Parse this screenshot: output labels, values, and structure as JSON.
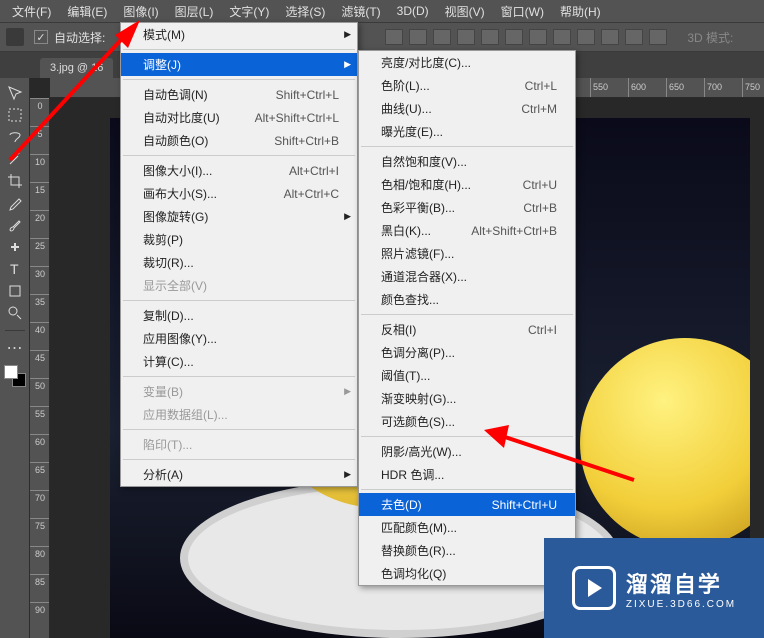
{
  "menubar": [
    "文件(F)",
    "编辑(E)",
    "图像(I)",
    "图层(L)",
    "文字(Y)",
    "选择(S)",
    "滤镜(T)",
    "3D(D)",
    "视图(V)",
    "窗口(W)",
    "帮助(H)"
  ],
  "options": {
    "auto_select": "自动选择:",
    "mode_3d": "3D 模式:"
  },
  "doc_tab": "3.jpg @ 16",
  "ruler_h": [
    "550",
    "600",
    "650",
    "700",
    "750"
  ],
  "ruler_v": [
    "0",
    "5",
    "10",
    "15",
    "20",
    "25",
    "30",
    "35",
    "40",
    "45",
    "50",
    "55",
    "60",
    "65",
    "70",
    "75",
    "80",
    "85",
    "90"
  ],
  "menu1": {
    "groups": [
      [
        {
          "label": "模式(M)",
          "arrow": true
        }
      ],
      [
        {
          "label": "调整(J)",
          "arrow": true,
          "hl": true
        }
      ],
      [
        {
          "label": "自动色调(N)",
          "shortcut": "Shift+Ctrl+L"
        },
        {
          "label": "自动对比度(U)",
          "shortcut": "Alt+Shift+Ctrl+L"
        },
        {
          "label": "自动颜色(O)",
          "shortcut": "Shift+Ctrl+B"
        }
      ],
      [
        {
          "label": "图像大小(I)...",
          "shortcut": "Alt+Ctrl+I"
        },
        {
          "label": "画布大小(S)...",
          "shortcut": "Alt+Ctrl+C"
        },
        {
          "label": "图像旋转(G)",
          "arrow": true
        },
        {
          "label": "裁剪(P)"
        },
        {
          "label": "裁切(R)..."
        },
        {
          "label": "显示全部(V)",
          "disabled": true
        }
      ],
      [
        {
          "label": "复制(D)..."
        },
        {
          "label": "应用图像(Y)..."
        },
        {
          "label": "计算(C)..."
        }
      ],
      [
        {
          "label": "变量(B)",
          "arrow": true,
          "disabled": true
        },
        {
          "label": "应用数据组(L)...",
          "disabled": true
        }
      ],
      [
        {
          "label": "陷印(T)...",
          "disabled": true
        }
      ],
      [
        {
          "label": "分析(A)",
          "arrow": true
        }
      ]
    ]
  },
  "menu2": {
    "groups": [
      [
        {
          "label": "亮度/对比度(C)..."
        },
        {
          "label": "色阶(L)...",
          "shortcut": "Ctrl+L"
        },
        {
          "label": "曲线(U)...",
          "shortcut": "Ctrl+M"
        },
        {
          "label": "曝光度(E)..."
        }
      ],
      [
        {
          "label": "自然饱和度(V)..."
        },
        {
          "label": "色相/饱和度(H)...",
          "shortcut": "Ctrl+U"
        },
        {
          "label": "色彩平衡(B)...",
          "shortcut": "Ctrl+B"
        },
        {
          "label": "黑白(K)...",
          "shortcut": "Alt+Shift+Ctrl+B"
        },
        {
          "label": "照片滤镜(F)..."
        },
        {
          "label": "通道混合器(X)..."
        },
        {
          "label": "颜色查找..."
        }
      ],
      [
        {
          "label": "反相(I)",
          "shortcut": "Ctrl+I"
        },
        {
          "label": "色调分离(P)..."
        },
        {
          "label": "阈值(T)..."
        },
        {
          "label": "渐变映射(G)..."
        },
        {
          "label": "可选颜色(S)..."
        }
      ],
      [
        {
          "label": "阴影/高光(W)..."
        },
        {
          "label": "HDR 色调..."
        }
      ],
      [
        {
          "label": "去色(D)",
          "shortcut": "Shift+Ctrl+U",
          "hl": true
        },
        {
          "label": "匹配颜色(M)..."
        },
        {
          "label": "替换颜色(R)..."
        },
        {
          "label": "色调均化(Q)"
        }
      ]
    ]
  },
  "logo": {
    "main": "溜溜自学",
    "sub": "ZIXUE.3D66.COM"
  }
}
